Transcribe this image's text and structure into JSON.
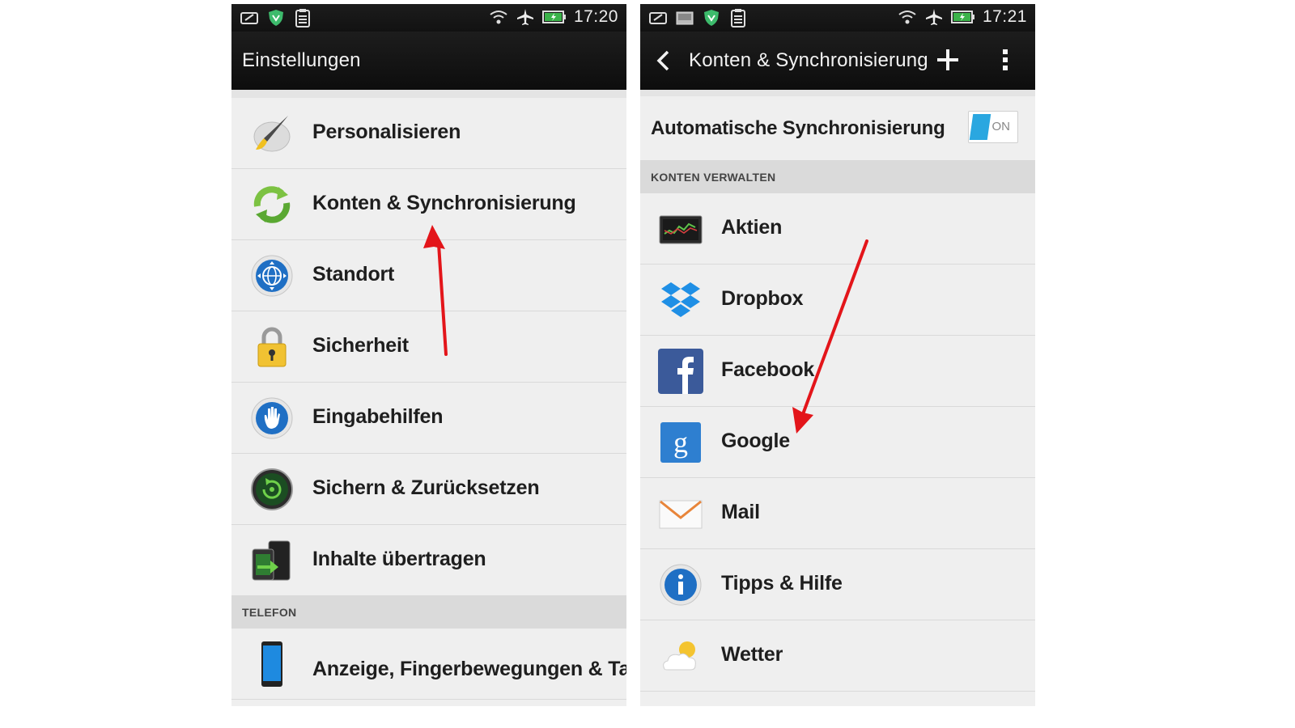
{
  "left": {
    "status": {
      "time": "17:20"
    },
    "title": "Einstellungen",
    "items": [
      {
        "label": "Personalisieren",
        "icon": "brush-icon"
      },
      {
        "label": "Konten & Synchronisierung",
        "icon": "sync-icon"
      },
      {
        "label": "Standort",
        "icon": "globe-icon"
      },
      {
        "label": "Sicherheit",
        "icon": "lock-icon"
      },
      {
        "label": "Eingabehilfen",
        "icon": "hand-icon"
      },
      {
        "label": "Sichern & Zurücksetzen",
        "icon": "backup-icon"
      },
      {
        "label": "Inhalte übertragen",
        "icon": "transfer-icon"
      }
    ],
    "section": "TELEFON",
    "items2": [
      {
        "label": "Anzeige, Fingerbewegungen & Tasten",
        "icon": "phone-icon"
      }
    ]
  },
  "right": {
    "status": {
      "time": "17:21"
    },
    "title": "Konten & Synchronisierung",
    "auto_sync": {
      "label": "Automatische Synchronisierung",
      "toggle": "ON",
      "accent": "#2aa7e0"
    },
    "section": "KONTEN VERWALTEN",
    "items": [
      {
        "label": "Aktien",
        "icon": "stocks-icon"
      },
      {
        "label": "Dropbox",
        "icon": "dropbox-icon"
      },
      {
        "label": "Facebook",
        "icon": "facebook-icon"
      },
      {
        "label": "Google",
        "icon": "google-icon"
      },
      {
        "label": "Mail",
        "icon": "mail-icon"
      },
      {
        "label": "Tipps & Hilfe",
        "icon": "info-icon"
      },
      {
        "label": "Wetter",
        "icon": "weather-icon"
      }
    ]
  },
  "annotation_color": "#e3151a"
}
